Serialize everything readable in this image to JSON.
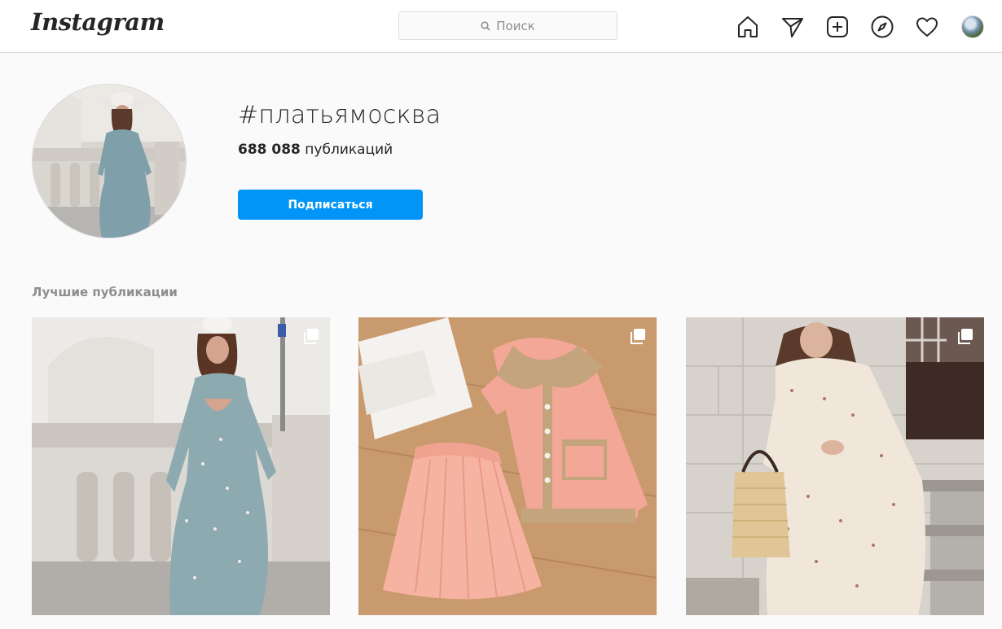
{
  "topbar": {
    "logo_text": "Instagram",
    "search": {
      "placeholder": "Поиск"
    },
    "icons": [
      "home-icon",
      "direct-icon",
      "new-post-icon",
      "explore-icon",
      "activity-icon",
      "profile-avatar"
    ]
  },
  "header": {
    "hashtag": "#платьямосква",
    "posts_count": "688 088",
    "posts_label": "публикаций",
    "follow_button": "Подписаться"
  },
  "top_posts": {
    "title": "Лучшие публикации",
    "items": [
      {
        "subject": "woman in blue floral dress and white hat by balustrade",
        "badge": "carousel-icon"
      },
      {
        "subject": "pink knit cardigan with pleated pink skirt on wooden floor",
        "badge": "carousel-icon"
      },
      {
        "subject": "woman in floral ruffled dress with straw bag",
        "badge": "carousel-icon"
      }
    ]
  },
  "colors": {
    "accent": "#0095f6",
    "background": "#fafafa",
    "border": "#dbdbdb",
    "text": "#262626",
    "muted": "#8e8e8e"
  }
}
